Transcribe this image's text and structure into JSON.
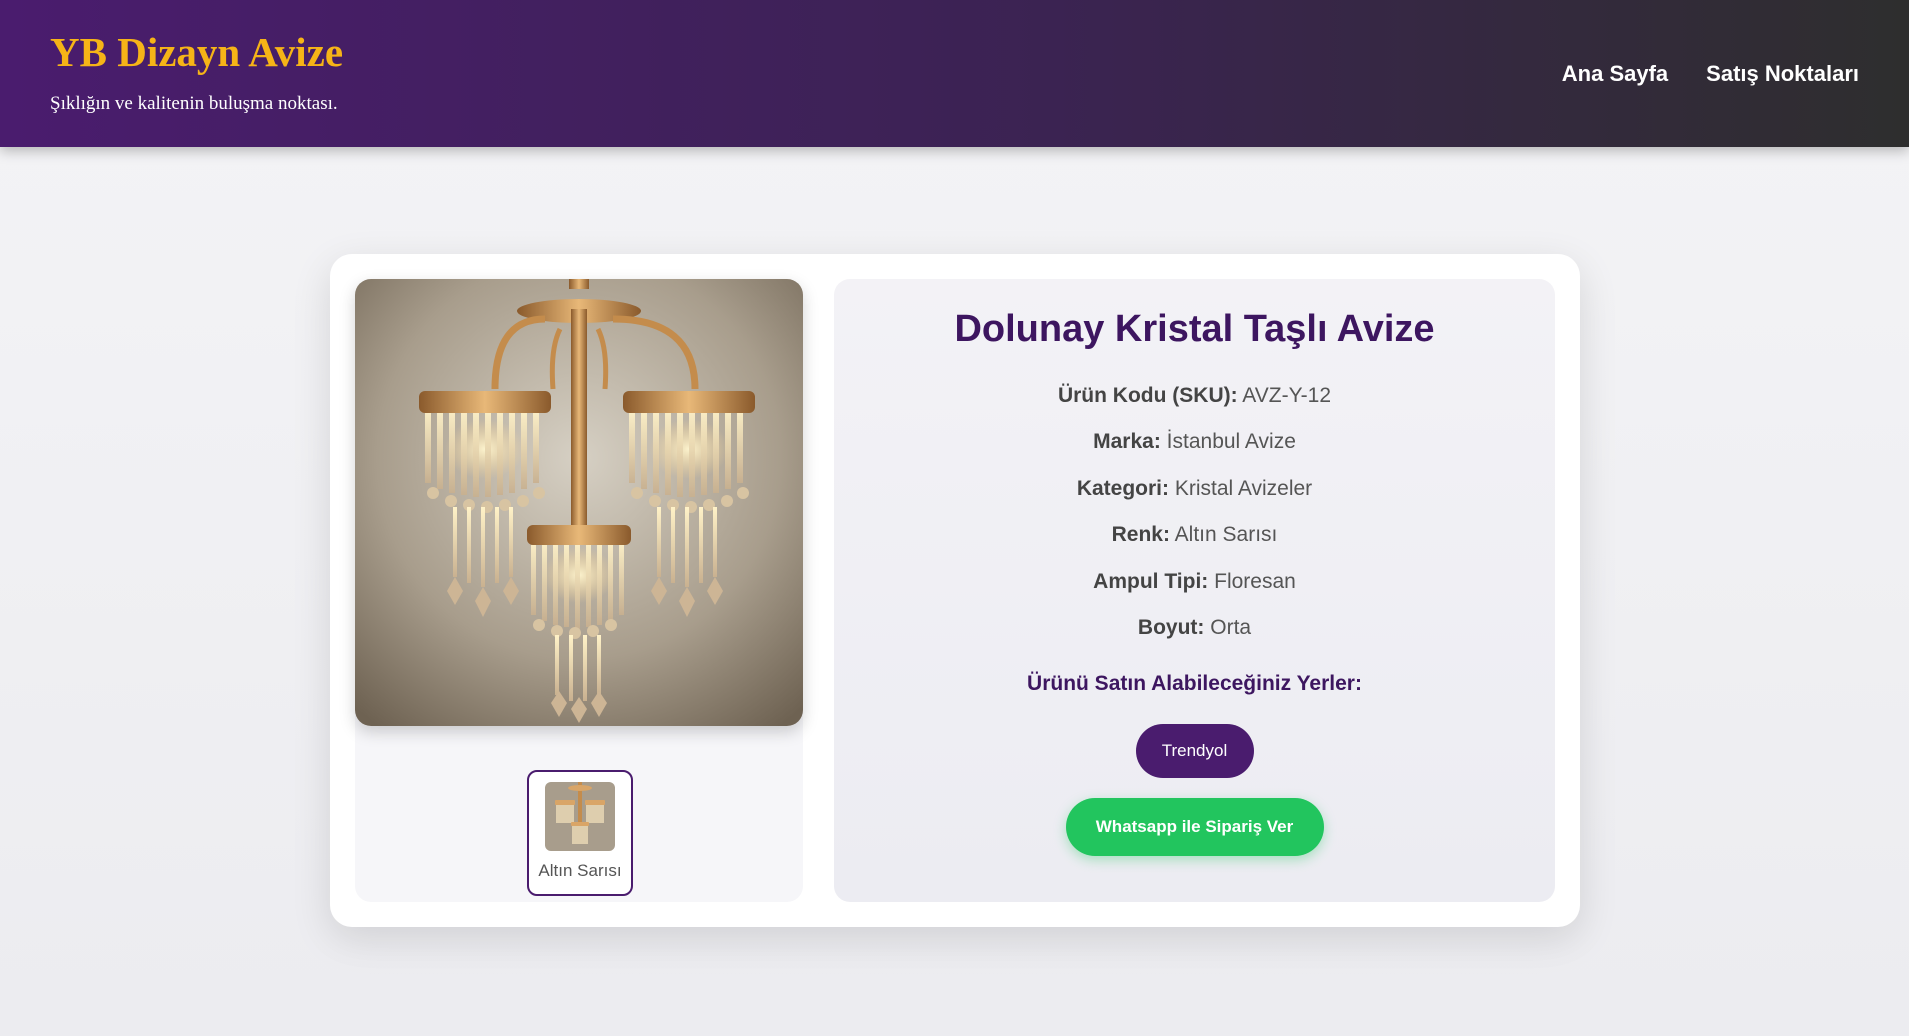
{
  "header": {
    "brand": "YB Dizayn Avize",
    "tagline": "Şıklığın ve kalitenin buluşma noktası.",
    "nav": [
      "Ana Sayfa",
      "Satış Noktaları"
    ]
  },
  "product": {
    "name": "Dolunay Kristal Taşlı Avize",
    "specs": [
      {
        "key": "Ürün Kodu (SKU):",
        "value": "AVZ-Y-12"
      },
      {
        "key": "Marka:",
        "value": "İstanbul Avize"
      },
      {
        "key": "Kategori:",
        "value": "Kristal Avizeler"
      },
      {
        "key": "Renk:",
        "value": "Altın Sarısı"
      },
      {
        "key": "Ampul Tipi:",
        "value": "Floresan"
      },
      {
        "key": "Boyut:",
        "value": "Orta"
      }
    ],
    "where_to_buy_title": "Ürünü Satın Alabileceğiniz Yerler:",
    "store_button": "Trendyol",
    "whatsapp_button": "Whatsapp ile Sipariş Ver",
    "variant_label": "Altın Sarısı"
  },
  "colors": {
    "brand": "#f6b417",
    "primary": "#4a1c6e",
    "whatsapp": "#22c55e"
  }
}
